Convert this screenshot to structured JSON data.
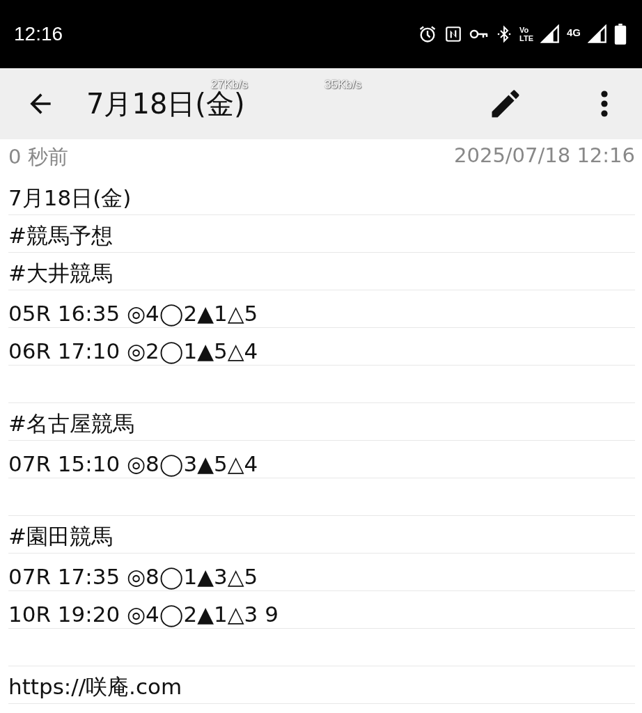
{
  "status_bar": {
    "time": "12:16",
    "volte": {
      "top": "Vo",
      "bottom": "LTE"
    },
    "network_type": "4G"
  },
  "speed_meters": [
    "27Kb/s",
    "35Kb/s"
  ],
  "toolbar": {
    "title": "7月18日(金)"
  },
  "meta": {
    "relative_time": "0 秒前",
    "timestamp": "2025/07/18 12:16"
  },
  "note_lines": [
    {
      "kind": "text",
      "text": "7月18日(金)"
    },
    {
      "kind": "text",
      "text": "#競馬予想"
    },
    {
      "kind": "text",
      "text": "#大井競馬"
    },
    {
      "kind": "text",
      "text": "05R 16:35 ◎4◯2▲1△5"
    },
    {
      "kind": "text",
      "text": "06R 17:10 ◎2◯1▲5△4"
    },
    {
      "kind": "blank"
    },
    {
      "kind": "text",
      "text": "#名古屋競馬"
    },
    {
      "kind": "text",
      "text": "07R 15:10 ◎8◯3▲5△4"
    },
    {
      "kind": "blank"
    },
    {
      "kind": "text",
      "text": "#園田競馬"
    },
    {
      "kind": "text",
      "text": "07R 17:35 ◎8◯1▲3△5"
    },
    {
      "kind": "text",
      "text": "10R 19:20 ◎4◯2▲1△3 9"
    },
    {
      "kind": "blank"
    },
    {
      "kind": "text",
      "text": "https://咲庵.com"
    }
  ]
}
